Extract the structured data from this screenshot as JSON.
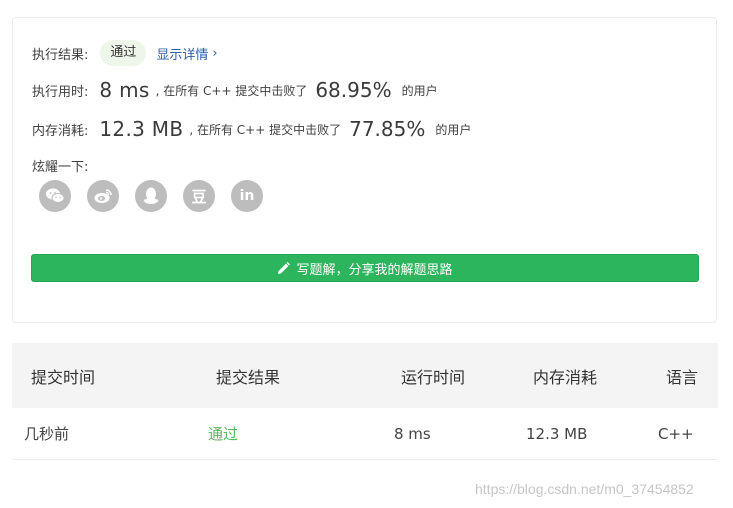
{
  "result": {
    "label": "执行结果:",
    "status": "通过",
    "details_link": "显示详情"
  },
  "runtime": {
    "label": "执行用时:",
    "value": "8 ms",
    "beat_prefix": ", 在所有 C++ 提交中击败了",
    "percent": "68.95%",
    "suffix": "的用户"
  },
  "memory": {
    "label": "内存消耗:",
    "value": "12.3 MB",
    "beat_prefix": ", 在所有 C++ 提交中击败了",
    "percent": "77.85%",
    "suffix": "的用户"
  },
  "share": {
    "label": "炫耀一下:",
    "icons": [
      "wechat-icon",
      "weibo-icon",
      "qq-icon",
      "douban-icon",
      "linkedin-icon"
    ],
    "douban_glyph": "豆",
    "linkedin_glyph": "in"
  },
  "write_solution_button": "写题解，分享我的解题思路",
  "table": {
    "headers": [
      "提交时间",
      "提交结果",
      "运行时间",
      "内存消耗",
      "语言"
    ],
    "rows": [
      [
        "几秒前",
        "通过",
        "8 ms",
        "12.3 MB",
        "C++"
      ]
    ]
  },
  "watermark": "https://blog.csdn.net/m0_37454852",
  "colors": {
    "accent_green": "#2db55d",
    "pass_green": "#5cb85c",
    "link_blue": "#2e5ea8",
    "icon_gray": "#bdbdbd"
  }
}
